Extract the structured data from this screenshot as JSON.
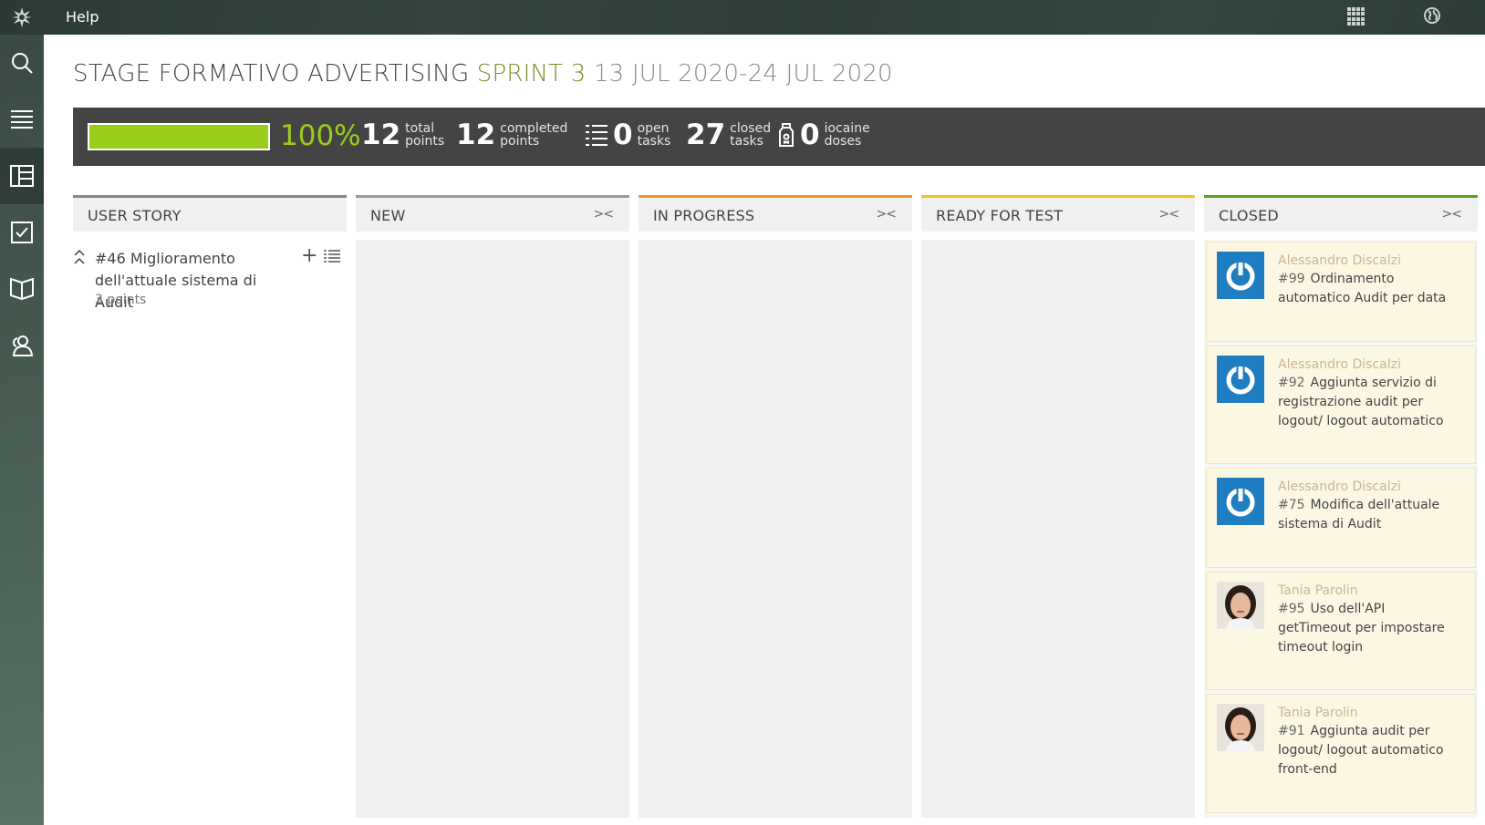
{
  "topbar": {
    "help_label": "Help",
    "icons": [
      "taiga-logo-icon",
      "apps-grid-icon",
      "globe-icon"
    ]
  },
  "sidebar": {
    "items": [
      {
        "icon": "search-icon"
      },
      {
        "icon": "menu-list-icon"
      },
      {
        "icon": "kanban-board-icon",
        "active": true
      },
      {
        "icon": "issues-checkbox-icon"
      },
      {
        "icon": "wiki-book-icon"
      },
      {
        "icon": "team-icon"
      }
    ]
  },
  "header": {
    "project": "STAGE FORMATIVO ADVERTISING",
    "sprint": "SPRINT 3",
    "dates": "13 JUL 2020-24 JUL 2020"
  },
  "stats": {
    "progress": 1.0,
    "percent_label": "100%",
    "total_points": "12",
    "total_points_label": "total points",
    "completed_points": "12",
    "completed_points_label": "completed points",
    "open_tasks": "0",
    "open_tasks_label": "open tasks",
    "closed_tasks": "27",
    "closed_tasks_label": "closed tasks",
    "iocaine": "0",
    "iocaine_label": "iocaine doses",
    "colors": {
      "progress": "#9acd1b",
      "bar_bg": "#444444"
    }
  },
  "columns": [
    {
      "label": "USER STORY",
      "color": "#888888"
    },
    {
      "label": "NEW",
      "color": "#999999"
    },
    {
      "label": "IN PROGRESS",
      "color": "#f0932b"
    },
    {
      "label": "READY FOR TEST",
      "color": "#f5c518"
    },
    {
      "label": "CLOSED",
      "color": "#5aa118"
    }
  ],
  "user_story": {
    "ref": "#46",
    "subject": "Miglioramento dell'attuale sistema di Audit",
    "points": "3 points"
  },
  "closed_cards": [
    {
      "assignee": "Alessandro Discalzi",
      "ref": "#99",
      "subject": "Ordinamento automatico Audit per data",
      "avatar": "default"
    },
    {
      "assignee": "Alessandro Discalzi",
      "ref": "#92",
      "subject": "Aggiunta servizio di registrazione audit per logout/ logout automatico",
      "avatar": "default"
    },
    {
      "assignee": "Alessandro Discalzi",
      "ref": "#75",
      "subject": "Modifica dell'attuale sistema di Audit",
      "avatar": "default"
    },
    {
      "assignee": "Tania Parolin",
      "ref": "#95",
      "subject": "Uso dell'API getTimeout per impostare timeout login",
      "avatar": "photo"
    },
    {
      "assignee": "Tania Parolin",
      "ref": "#91",
      "subject": "Aggiunta audit per logout/ logout automatico front-end",
      "avatar": "photo"
    }
  ]
}
